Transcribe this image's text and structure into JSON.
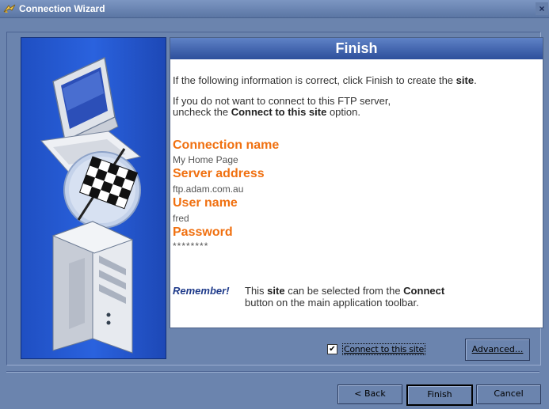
{
  "window": {
    "title": "Connection Wizard",
    "close_glyph": "×"
  },
  "header": {
    "title": "Finish"
  },
  "intro": {
    "line1_prefix": "If the following information is correct, click Finish to create the ",
    "line1_bold": "site",
    "line1_suffix": ".",
    "line2": "If you do not want to connect to this FTP server,",
    "line3_prefix": "uncheck the ",
    "line3_bold": "Connect to this site",
    "line3_suffix": " option."
  },
  "fields": {
    "connection_name_label": "Connection name",
    "connection_name_value": "My Home Page",
    "server_address_label": "Server address",
    "server_address_value": "ftp.adam.com.au",
    "user_name_label": "User name",
    "user_name_value": "fred",
    "password_label": "Password",
    "password_value": "********"
  },
  "remember": {
    "label": "Remember!",
    "line1_prefix": "This ",
    "line1_bold1": "site",
    "line1_mid": " can be selected from the ",
    "line1_bold2": "Connect",
    "line2": "button on the main application toolbar."
  },
  "options": {
    "connect_checkbox_label": "Connect to this site",
    "connect_checked": true
  },
  "buttons": {
    "advanced_label": "Advanced...",
    "back_label": "< Back",
    "finish_label": "Finish",
    "cancel_label": "Cancel"
  },
  "icons": {
    "title_icon": "wizard-icon",
    "left_art": [
      "monitor-icon",
      "checkered-flag-icon",
      "computer-tower-icon"
    ]
  },
  "colors": {
    "accent_orange": "#f07010",
    "header_blue": "#2d4f9b",
    "panel_blue": "#2a62de",
    "window_bg": "#6b84ae"
  }
}
